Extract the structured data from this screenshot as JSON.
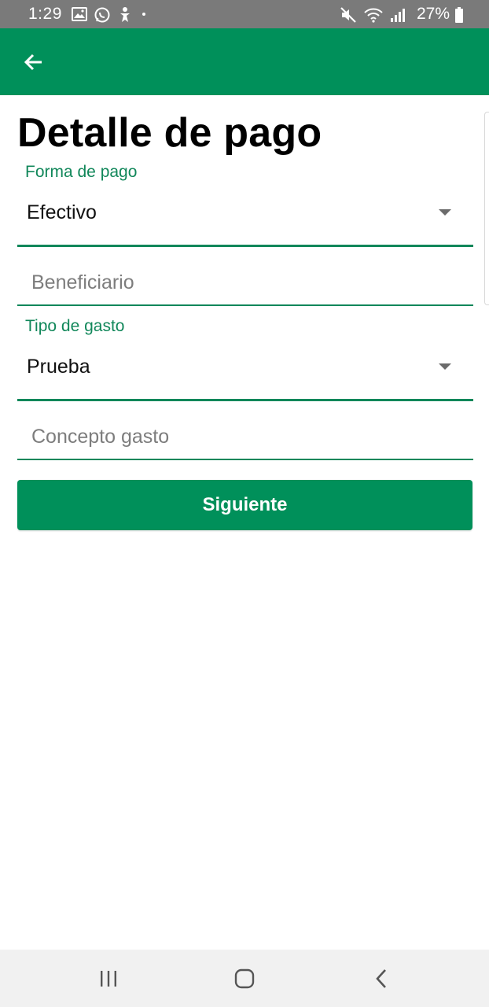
{
  "status_bar": {
    "time": "1:29",
    "battery_percent": "27%",
    "left_icons": [
      "gallery-icon",
      "whatsapp-icon",
      "accessibility-icon",
      "dot-icon"
    ],
    "right_icons": [
      "mute-icon",
      "wifi-icon",
      "signal-icon",
      "battery-icon"
    ]
  },
  "app_bar": {
    "back_icon": "arrow-back-icon",
    "color": "#00905a"
  },
  "page": {
    "title": "Detalle de pago"
  },
  "form": {
    "forma_pago": {
      "label": "Forma de pago",
      "value": "Efectivo"
    },
    "beneficiario": {
      "placeholder": "Beneficiario",
      "value": ""
    },
    "tipo_gasto": {
      "label": "Tipo de gasto",
      "value": "Prueba"
    },
    "concepto_gasto": {
      "placeholder": "Concepto gasto",
      "value": ""
    },
    "submit_label": "Siguiente"
  },
  "nav_bar": {
    "buttons": [
      "recent-apps-icon",
      "home-icon",
      "back-icon"
    ]
  },
  "colors": {
    "accent": "#00905a",
    "label": "#11875a",
    "status_bar": "#7a7a7a"
  }
}
